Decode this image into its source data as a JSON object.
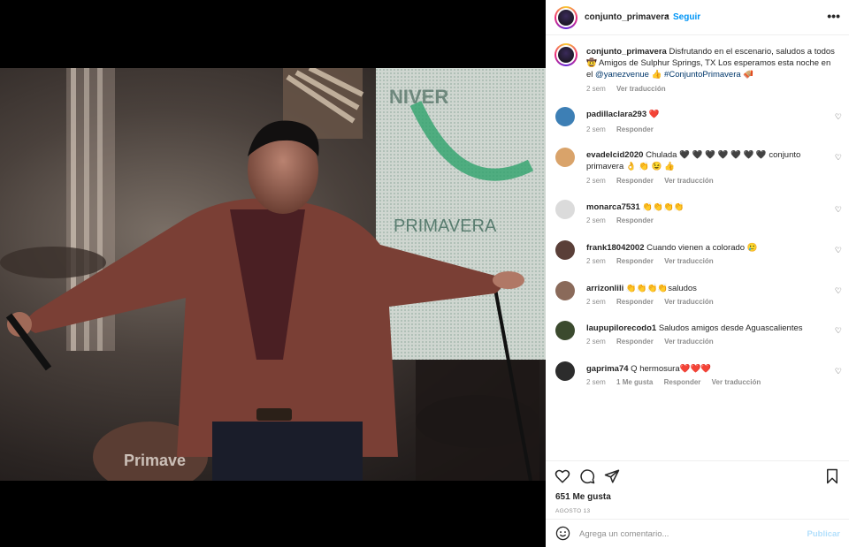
{
  "post": {
    "username": "conjunto_primavera",
    "follow_label": "Seguir",
    "more_label": "•••",
    "dot": "•"
  },
  "caption": {
    "username": "conjunto_primavera",
    "text1": "Disfrutando en el escenario, saludos a todos",
    "text2": "🤠 Amigos de Sulphur Springs, TX Los esperamos esta noche en el ",
    "mention": "@yanezvenue",
    "text3": " 👍 ",
    "hashtag": "#ConjuntoPrimavera",
    "text4": " 🪗",
    "time": "2 sem",
    "translate": "Ver traducción"
  },
  "comments": [
    {
      "user": "padillaclara293",
      "text": "",
      "emoji": "❤️",
      "time": "2 sem",
      "reply": "Responder",
      "translate": "",
      "likes": "",
      "color": "#3d7fb5"
    },
    {
      "user": "evadelcid2020",
      "text": "Chulada 🖤 🖤 🖤 🖤 🖤 🖤 🖤 conjunto primavera 👌 👏 😉 👍",
      "emoji": "",
      "time": "2 sem",
      "reply": "Responder",
      "translate": "Ver traducción",
      "likes": "",
      "color": "#d9a36a"
    },
    {
      "user": "monarca7531",
      "text": "👏👏👏👏",
      "emoji": "",
      "time": "2 sem",
      "reply": "Responder",
      "translate": "",
      "likes": "",
      "color": "#dbdbdb"
    },
    {
      "user": "frank18042002",
      "text": "Cuando vienen a colorado 🥲",
      "emoji": "",
      "time": "2 sem",
      "reply": "Responder",
      "translate": "Ver traducción",
      "likes": "",
      "color": "#5a3f38"
    },
    {
      "user": "arrizonlili",
      "text": "👏👏👏👏saludos",
      "emoji": "",
      "time": "2 sem",
      "reply": "Responder",
      "translate": "Ver traducción",
      "likes": "",
      "color": "#8a6a5a"
    },
    {
      "user": "laupupilorecodo1",
      "text": "Saludos amigos desde Aguascalientes",
      "emoji": "",
      "time": "2 sem",
      "reply": "Responder",
      "translate": "Ver traducción",
      "likes": "",
      "color": "#3b4a2e"
    },
    {
      "user": "gaprima74",
      "text": "Q hermosura",
      "emoji": "❤️❤️❤️",
      "time": "2 sem",
      "reply": "Responder",
      "translate": "Ver traducción",
      "likes": "1 Me gusta",
      "color": "#2c2c2c"
    }
  ],
  "likes_text": "651 Me gusta",
  "date_text": "AGOSTO 13",
  "add_comment": {
    "placeholder": "Agrega un comentario...",
    "publish_label": "Publicar"
  },
  "icons": {
    "like": "heart-icon",
    "comment": "comment-icon",
    "share": "share-icon",
    "save": "bookmark-icon",
    "emoji": "smiley-icon"
  },
  "colors": {
    "link": "#0095f6",
    "muted": "#8e8e8e",
    "heart_red": "#ed1c24"
  }
}
